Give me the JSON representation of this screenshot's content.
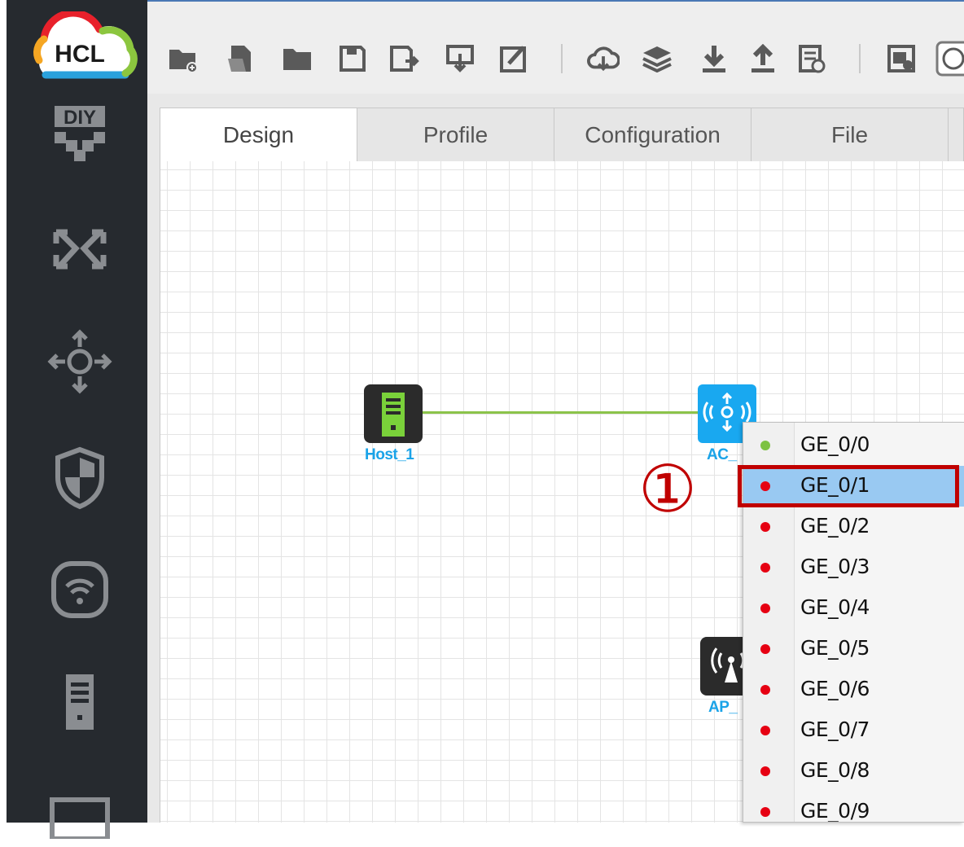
{
  "app": {
    "logo_text": "HCL"
  },
  "sidebar": {
    "items": [
      {
        "icon": "diy-icon",
        "text": "DIY"
      },
      {
        "icon": "switch-icon"
      },
      {
        "icon": "router-icon"
      },
      {
        "icon": "firewall-icon"
      },
      {
        "icon": "wireless-icon"
      },
      {
        "icon": "host-icon"
      },
      {
        "icon": "terminal-icon"
      }
    ]
  },
  "toolbar": {
    "buttons": [
      "new-project-icon",
      "open-recent-icon",
      "open-folder-icon",
      "save-icon",
      "save-as-icon",
      "export-icon",
      "edit-icon",
      "cloud-icon",
      "layers-icon",
      "download-icon",
      "upload-icon",
      "log-icon",
      "screenshot-icon",
      "settings-icon"
    ]
  },
  "tabs": [
    {
      "label": "Design",
      "active": true
    },
    {
      "label": "Profile",
      "active": false
    },
    {
      "label": "Configuration",
      "active": false
    },
    {
      "label": "File",
      "active": false
    }
  ],
  "canvas": {
    "nodes": [
      {
        "label": "Host_1",
        "type": "host"
      },
      {
        "label": "AC_",
        "type": "ac"
      },
      {
        "label": "AP_",
        "type": "ap"
      }
    ]
  },
  "port_menu": {
    "items": [
      {
        "label": "GE_0/0",
        "status_color": "#7dc242",
        "highlighted": false
      },
      {
        "label": "GE_0/1",
        "status_color": "#e60012",
        "highlighted": true
      },
      {
        "label": "GE_0/2",
        "status_color": "#e60012",
        "highlighted": false
      },
      {
        "label": "GE_0/3",
        "status_color": "#e60012",
        "highlighted": false
      },
      {
        "label": "GE_0/4",
        "status_color": "#e60012",
        "highlighted": false
      },
      {
        "label": "GE_0/5",
        "status_color": "#e60012",
        "highlighted": false
      },
      {
        "label": "GE_0/6",
        "status_color": "#e60012",
        "highlighted": false
      },
      {
        "label": "GE_0/7",
        "status_color": "#e60012",
        "highlighted": false
      },
      {
        "label": "GE_0/8",
        "status_color": "#e60012",
        "highlighted": false
      },
      {
        "label": "GE_0/9",
        "status_color": "#e60012",
        "highlighted": false
      }
    ]
  },
  "annotation": {
    "step_marker": "①",
    "color": "#c00000"
  }
}
